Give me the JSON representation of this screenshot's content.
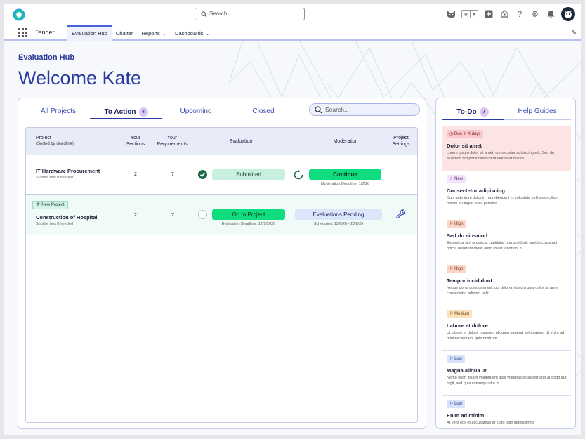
{
  "header": {
    "search_placeholder": "Search...",
    "utility_icons": [
      "cat-icon",
      "star-icon",
      "chevron-down-icon",
      "plus-square-icon",
      "bell-cloud-icon",
      "help-icon",
      "gear-icon",
      "notification-icon",
      "avatar-icon"
    ]
  },
  "nav": {
    "app_name": "Tender",
    "items": [
      {
        "label": "Evaluation Hub",
        "active": true,
        "has_menu": false
      },
      {
        "label": "Chatter",
        "active": false,
        "has_menu": false
      },
      {
        "label": "Reports",
        "active": false,
        "has_menu": true
      },
      {
        "label": "Dashboards",
        "active": false,
        "has_menu": true
      }
    ]
  },
  "hero": {
    "breadcrumb": "Evaluation Hub",
    "title": "Welcome Kate"
  },
  "main": {
    "tabs": [
      {
        "label": "All Projects",
        "active": false
      },
      {
        "label": "To Action",
        "active": true,
        "count": "4"
      },
      {
        "label": "Upcoming",
        "active": false
      },
      {
        "label": "Closed",
        "active": false
      }
    ],
    "search_placeholder": "Search...",
    "columns": {
      "project": "Project",
      "project_sub": "(Sorted by deadline)",
      "sections_1": "Your",
      "sections_2": "Sections",
      "requirements_1": "Your",
      "requirements_2": "Requirements",
      "evaluation": "Evaluation",
      "moderation": "Moderation",
      "settings_1": "Project",
      "settings_2": "Settings"
    },
    "rows": [
      {
        "title": "IT Hardware Procurement",
        "subtitle": "Subtitle text if needed",
        "sections": "2",
        "requirements": "7",
        "evaluation_label": "Submitted",
        "moderation_label": "Continue",
        "moderation_note": "Moderation Deadline: 1/3/26"
      },
      {
        "badge": "New Project",
        "title": "Construction of Hospital",
        "subtitle": "Subtitle text if needed",
        "sections": "2",
        "requirements": "7",
        "evaluation_label": "Go to Project",
        "evaluation_note": "Evaluation Deadline: 12/9/2026",
        "moderation_label": "Evaluations Pending",
        "moderation_note": "Scheduled: 13/6/26 - 28/8/26"
      }
    ]
  },
  "todo": {
    "tabs": [
      {
        "label": "To-Do",
        "active": true,
        "count": "7"
      },
      {
        "label": "Help Guides",
        "active": false
      }
    ],
    "items": [
      {
        "priority": "Due in X days",
        "kind": "due",
        "title": "Dolor sit amet",
        "desc": "Lorem ipsum dolor sit amet, consectetur adipiscing elit. Sed do eiusmod tempor incididunt ut labore et dolore..."
      },
      {
        "priority": "New",
        "kind": "new",
        "title": "Consectetur adipiscing",
        "desc": "Duis aute irure dolor in reprehenderit in voluptate velit esse cillum dolore eu fugiat nulla pariatur."
      },
      {
        "priority": "High",
        "kind": "high",
        "title": "Sed do eiusmod",
        "desc": "Excepteur sint occaecat cupidatat non proident, sunt in culpa qui officia deserunt mollit anim id est laborum. S..."
      },
      {
        "priority": "High",
        "kind": "high",
        "title": "Tempor incididunt",
        "desc": "Neque porro quisquam est, qui dolorem ipsum quia dolor sit amet consectetur adipisci velit."
      },
      {
        "priority": "Medium",
        "kind": "medium",
        "title": "Labore et dolore",
        "desc": "Ut labore et dolore magnam aliquam quaerat voluptatem. Ut enim ad minima veniam, quis nostrum..."
      },
      {
        "priority": "Low",
        "kind": "low",
        "title": "Magna aliqua ut",
        "desc": "Nemo enim ipsam voluptatem quia voluptas sit aspernatur aut odit aut fugit, sed quia consequuntur m..."
      },
      {
        "priority": "Low",
        "kind": "low",
        "title": "Enim ad minim",
        "desc": "At vero eos et accusamus et iusto odio dignissimos"
      }
    ]
  },
  "colors": {
    "brand_blue": "#2a3a9e",
    "action_green": "#0fdc7f",
    "submitted_green": "#c7f1de",
    "pending_blue": "#dce6fb"
  }
}
